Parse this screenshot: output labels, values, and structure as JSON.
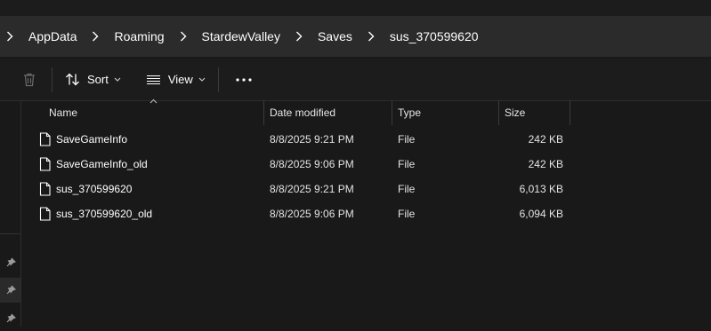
{
  "breadcrumb": {
    "items": [
      "AppData",
      "Roaming",
      "StardewValley",
      "Saves",
      "sus_370599620"
    ]
  },
  "toolbar": {
    "sort_label": "Sort",
    "view_label": "View"
  },
  "columns": {
    "name": "Name",
    "date": "Date modified",
    "type": "Type",
    "size": "Size"
  },
  "files": [
    {
      "name": "SaveGameInfo",
      "date": "8/8/2025 9:21 PM",
      "type": "File",
      "size": "242 KB"
    },
    {
      "name": "SaveGameInfo_old",
      "date": "8/8/2025 9:06 PM",
      "type": "File",
      "size": "242 KB"
    },
    {
      "name": "sus_370599620",
      "date": "8/8/2025 9:21 PM",
      "type": "File",
      "size": "6,013 KB"
    },
    {
      "name": "sus_370599620_old",
      "date": "8/8/2025 9:06 PM",
      "type": "File",
      "size": "6,094 KB"
    }
  ],
  "icons": {
    "delete": "trash-icon",
    "sort": "sort-arrows-icon",
    "view": "view-lines-icon",
    "more": "more-dots-icon",
    "file": "file-icon",
    "pin": "pin-icon",
    "separator": "chevron-right-icon"
  },
  "colors": {
    "background": "#191919",
    "address_bar": "#2b2b2b",
    "text": "#ffffff",
    "divider": "#3a3a3a"
  }
}
